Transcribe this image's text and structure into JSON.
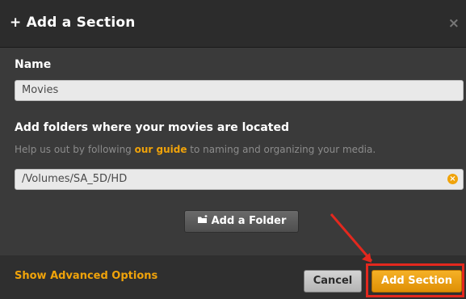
{
  "dialog": {
    "title": "+ Add a Section",
    "close_glyph": "×",
    "name_label": "Name",
    "name_value": "Movies",
    "folders_label": "Add folders where your movies are located",
    "help_prefix": "Help us out by following ",
    "help_link": "our guide",
    "help_suffix": " to naming and organizing your media.",
    "folder_path": "/Volumes/SA_5D/HD",
    "clear_glyph": "×",
    "add_folder_label": "Add a Folder",
    "advanced_link": "Show Advanced Options",
    "cancel_label": "Cancel",
    "add_section_label": "Add Section"
  },
  "icons": {
    "close": "close-icon",
    "clear": "clear-circle-icon",
    "folder": "folder-add-icon",
    "arrow": "annotation-arrow-icon"
  },
  "colors": {
    "accent": "#f0a30a",
    "dialog_bg": "#3a3a3a",
    "header_bg": "#2c2c2c",
    "highlight": "#e3281e"
  }
}
